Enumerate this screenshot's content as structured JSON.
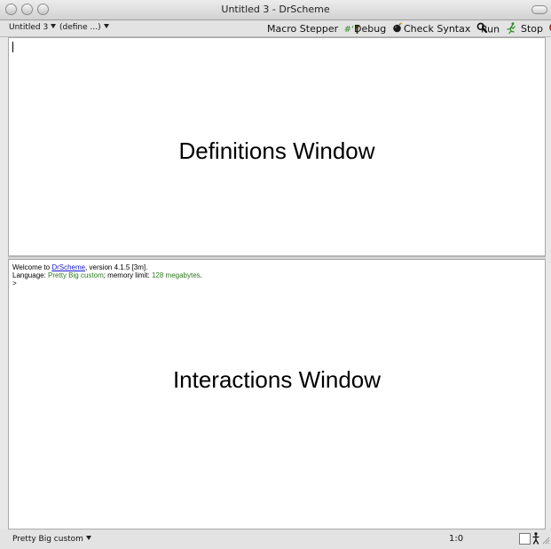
{
  "window": {
    "title": "Untitled 3 - DrScheme"
  },
  "toolbar": {
    "file_popup": "Untitled 3",
    "define_popup": "(define ...)",
    "macro_stepper_label": "Macro Stepper",
    "macro_stepper_icon_text": "#'",
    "debug_label": "Debug",
    "check_syntax_label": "Check Syntax",
    "run_label": "Run",
    "stop_label": "Stop"
  },
  "definitions": {
    "label": "Definitions Window"
  },
  "interactions": {
    "welcome_prefix": "Welcome to ",
    "welcome_link": "DrScheme",
    "welcome_suffix": ", version 4.1.5 [3m].",
    "language_prefix": "Language: ",
    "language_name": "Pretty Big custom",
    "memory_prefix": "; memory limit: ",
    "memory_value": "128 megabytes",
    "memory_suffix": ".",
    "prompt": ">",
    "label": "Interactions Window"
  },
  "statusbar": {
    "language": "Pretty Big custom",
    "position": "1:0"
  },
  "colors": {
    "link": "#1a1acc",
    "green_text": "#2d7a1e",
    "stop_red": "#d9281e",
    "run_green": "#2f8a2a"
  },
  "icons": {
    "macro_stepper": "macro-stepper-icon",
    "debug": "bomb-icon",
    "check_syntax": "magnifier-icon",
    "run": "running-man-icon",
    "stop": "stop-icon",
    "gc": "walking-man-icon"
  }
}
